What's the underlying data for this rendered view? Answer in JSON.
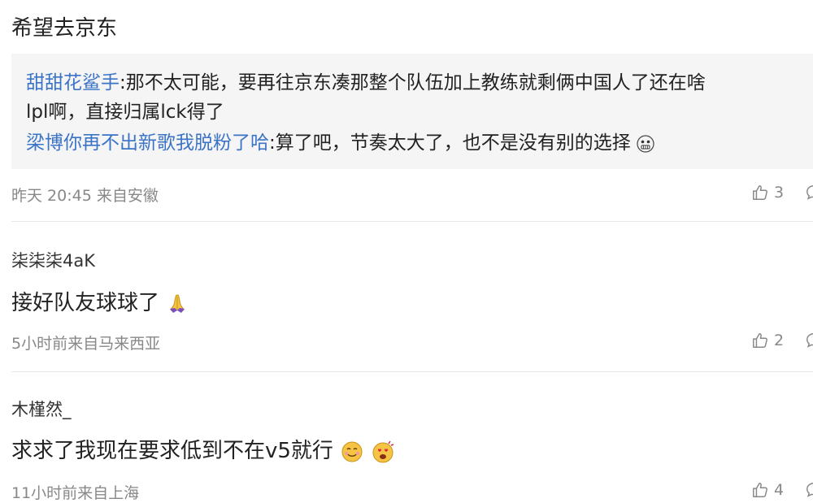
{
  "comment1": {
    "text": "希望去京东",
    "replies": [
      {
        "user": "甜甜花鲨手",
        "text": ":那不太可能，要再往京东凑那整个队伍加上教练就剩俩中国人了还在啥",
        "text_cont": "lpl啊，直接归属lck得了"
      },
      {
        "user": "梁博你再不出新歌我脱粉了哈",
        "text": ":算了吧，节奏太大了，也不是没有别的选择"
      }
    ],
    "meta": "昨天 20:45 来自安徽",
    "likes": "3"
  },
  "comment2": {
    "user": "柒柒柒4aK",
    "text": "接好队友球球了",
    "meta": "5小时前来自马来西亚",
    "likes": "2"
  },
  "comment3": {
    "user": "木槿然_",
    "text": "求求了我现在要求低到不在v5就行",
    "meta": "11小时前来自上海",
    "likes": "4"
  },
  "icons": {
    "like": "thumbs-up-icon",
    "reply": "comment-bubble-icon"
  },
  "colors": {
    "link": "#3b74c7",
    "meta": "#888888",
    "reply_bg": "#f5f5f5"
  }
}
